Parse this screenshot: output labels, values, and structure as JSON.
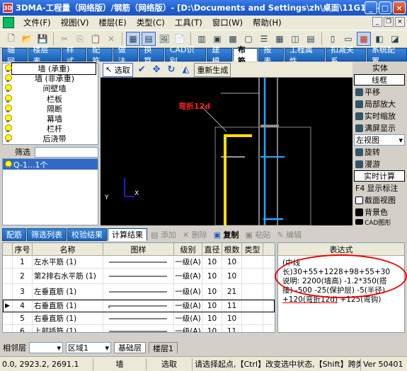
{
  "window": {
    "title": "3DMA-工程量（网络版）/钢筋（网络版）- [D:\\Documents and Settings\\zh\\桌面\\11G101-墙..."
  },
  "menu": [
    "文件(F)",
    "视图(V)",
    "楼层(E)",
    "类型(C)",
    "工具(T)",
    "窗口(W)",
    "帮助(H)"
  ],
  "toptabs": [
    "轴网",
    "楼层表",
    "样式",
    "配筋",
    "做法",
    "换算",
    "CAD识别",
    "建模",
    "布筋",
    "报表",
    "工程属性",
    "扣减关系",
    "系统配置"
  ],
  "toptab_active": "布筋",
  "tree": [
    "墙 (承重)",
    "墙 (非承重)",
    "间壁墙",
    "栏板",
    "隔断",
    "幕墙",
    "栏杆",
    "后浇带"
  ],
  "filter_label": "筛选",
  "filter_result": "Q-1...1个",
  "canvas_tools": {
    "select": "选取",
    "regen": "重新生成"
  },
  "canvas": {
    "annotation": "弯折12d",
    "axis_x": "X",
    "axis_y": "Y"
  },
  "right_panel": {
    "entity": "实体",
    "frame": "线框",
    "pan": "平移",
    "zoom_local": "局部放大",
    "zoom_realtime": "实时缩放",
    "full_screen": "满屏显示",
    "view_combo": "左视图",
    "rotate": "旋转",
    "roam": "漫游",
    "realtime_calc": "实时计算",
    "f4_label": "显示标注",
    "section_view": "截面视图",
    "bg_color": "背景色",
    "cad_shape": "CAD图形"
  },
  "bottom_tabs": [
    "配筋",
    "筛选列表",
    "校验结果",
    "计算结果"
  ],
  "bottom_tab_active": "计算结果",
  "bottom_actions": {
    "add": "添加",
    "delete": "删除",
    "copy": "复制",
    "paste": "粘贴",
    "edit": "编辑"
  },
  "table": {
    "headers": {
      "no": "序号",
      "name": "名称",
      "shape": "图样",
      "grade": "级别",
      "dia": "直径",
      "count": "根数",
      "type": "类型"
    },
    "rows": [
      {
        "no": "1",
        "name": "左水平筋 (1)",
        "grade": "一级(A)",
        "dia": "10",
        "count": "10",
        "type": "",
        "shape": "line"
      },
      {
        "no": "2",
        "name": "第2排右水平筋 (1)",
        "grade": "一级(A)",
        "dia": "10",
        "count": "10",
        "type": "",
        "shape": "line"
      },
      {
        "no": "3",
        "name": "左垂直筋 (1)",
        "grade": "一级(A)",
        "dia": "10",
        "count": "21",
        "type": "",
        "shape": "line"
      },
      {
        "no": "4",
        "name": "右垂直筋 (1)",
        "grade": "一级(A)",
        "dia": "10",
        "count": "11",
        "type": "",
        "shape": "hook"
      },
      {
        "no": "5",
        "name": "右垂直筋 (1)",
        "grade": "一级(A)",
        "dia": "10",
        "count": "10",
        "type": "",
        "shape": "line"
      },
      {
        "no": "6",
        "name": "上部插筋 (1)",
        "grade": "一级(A)",
        "dia": "10",
        "count": "11",
        "type": "",
        "shape": "line"
      }
    ]
  },
  "expression": {
    "header": "表达式",
    "line1": "(中线长)30+55+1228+98+55+30",
    "line2": "说明: 2200(墙高) -1.2*350(搭",
    "line3": "接) -500 -25(保护层) -5(半径)",
    "line4a": "+120(弯折12d)",
    "line4b": "+125(弯钩)"
  },
  "floor_row": {
    "floor_label": "相邻层",
    "floor_value": "",
    "zone_label": "区域1",
    "tab1": "基础层",
    "tab2": "楼层1"
  },
  "status": {
    "coords": "0.0, 2923.2, 2691.1",
    "object": "墙",
    "mode": "选取",
    "hint": "请选择起点,【Ctrl】改变选中状态,【Shift】跨类",
    "version": "Ver 50401"
  }
}
